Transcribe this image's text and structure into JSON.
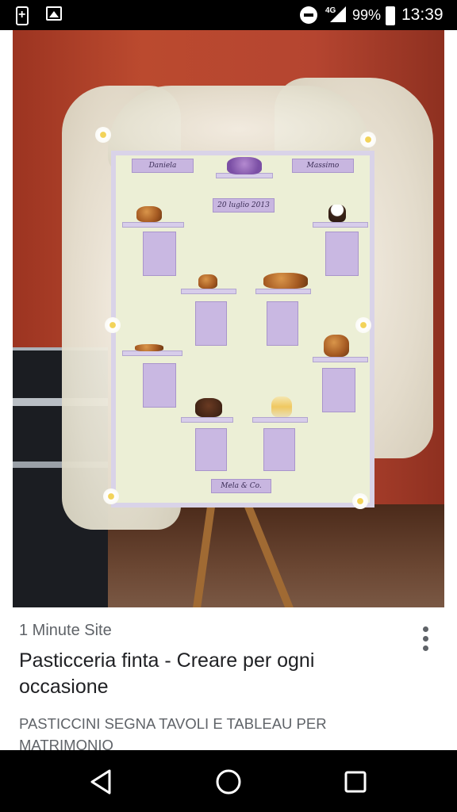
{
  "status_bar": {
    "network": "4G",
    "battery_percent": "99%",
    "time": "13:39",
    "icons": [
      "battery-saver-icon",
      "image-notification-icon",
      "do-not-disturb-icon",
      "signal-icon",
      "battery-icon"
    ]
  },
  "photo": {
    "board_labels": {
      "name_left": "Daniela",
      "name_right": "Massimo",
      "date": "20 luglio 2013",
      "footer": "Mela & Co."
    }
  },
  "result": {
    "source": "1 Minute Site",
    "title": "Pasticceria finta - Creare per ogni occasione",
    "description": "PASTICCINI SEGNA TAVOLI E TABLEAU PER MATRIMONIO",
    "more_icon": "more-vert-icon"
  },
  "nav_bar": {
    "icons": [
      "back-icon",
      "home-icon",
      "recents-icon"
    ]
  },
  "colors": {
    "status_bar_bg": "#000000",
    "caption_bg": "#ffffff",
    "title_text": "#202124",
    "secondary_text": "#5f6368"
  }
}
